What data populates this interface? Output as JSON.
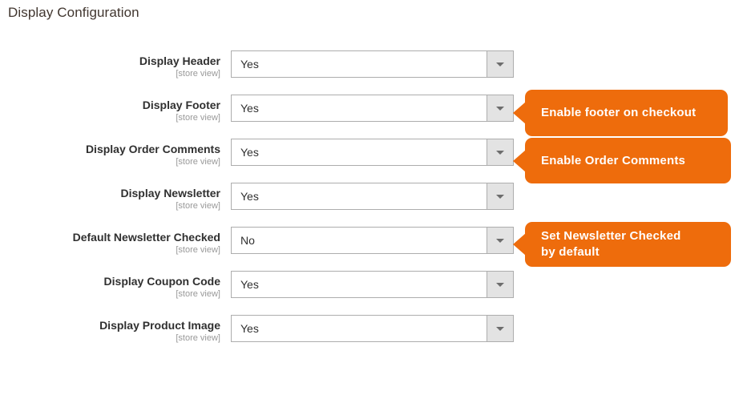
{
  "page": {
    "title": "Display Configuration"
  },
  "scope_label": "[store view]",
  "fields": [
    {
      "label": "Display Header",
      "scope": "[store view]",
      "value": "Yes"
    },
    {
      "label": "Display Footer",
      "scope": "[store view]",
      "value": "Yes"
    },
    {
      "label": "Display Order Comments",
      "scope": "[store view]",
      "value": "Yes"
    },
    {
      "label": "Display Newsletter",
      "scope": "[store view]",
      "value": "Yes"
    },
    {
      "label": "Default Newsletter Checked",
      "scope": "[store view]",
      "value": "No"
    },
    {
      "label": "Display Coupon Code",
      "scope": "[store view]",
      "value": "Yes"
    },
    {
      "label": "Display Product Image",
      "scope": "[store view]",
      "value": "Yes"
    }
  ],
  "callouts": {
    "footer": "Enable footer on checkout",
    "order_comments": "Enable Order Comments",
    "newsletter_line1": "Set Newsletter Checked",
    "newsletter_line2": "by default"
  },
  "colors": {
    "callout_orange": "#ee6c0c",
    "title_text": "#41362f",
    "label_text": "#303030",
    "scope_text": "#999999",
    "select_border": "#adadad",
    "select_button": "#e3e3e3"
  }
}
